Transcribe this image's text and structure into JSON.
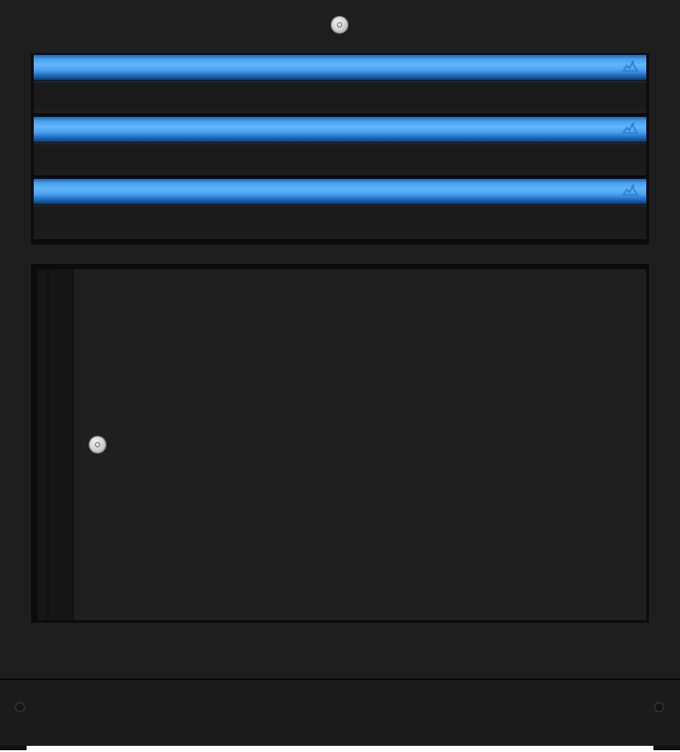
{
  "cabinet": {
    "description_colors": {
      "body": "#1e1e1e",
      "handle_accent": "#4aa2ee",
      "lock_metal": "#d0d0d0"
    },
    "top_lock": {
      "icon": "lock-icon"
    },
    "drawers": [
      {
        "handle_color": "#4aa2ee",
        "logo_icon": "brand-logo-icon"
      },
      {
        "handle_color": "#4aa2ee",
        "logo_icon": "brand-logo-icon"
      },
      {
        "handle_color": "#4aa2ee",
        "logo_icon": "brand-logo-icon"
      }
    ],
    "door": {
      "lock_icon": "lock-icon"
    },
    "plinth": {
      "screw_icons": [
        "screw-icon",
        "screw-icon"
      ]
    }
  }
}
